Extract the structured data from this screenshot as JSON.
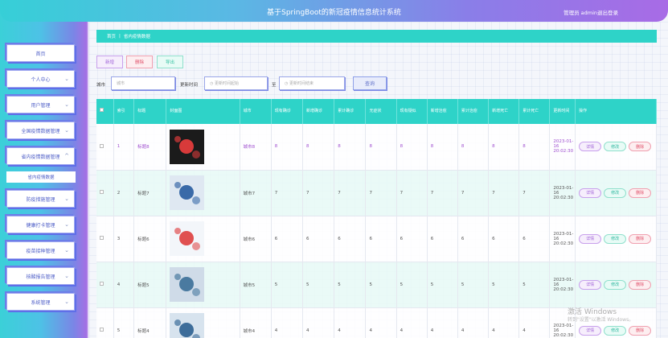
{
  "header": {
    "title": "基于SpringBoot的新冠疫情信息统计系统",
    "user": "管理员 admin",
    "logout": "退出登录"
  },
  "sidebar": {
    "items": [
      {
        "label": "首页",
        "chev": ""
      },
      {
        "label": "个人中心",
        "chev": "⌄"
      },
      {
        "label": "用户管理",
        "chev": "⌄"
      },
      {
        "label": "全国疫情数据管理",
        "chev": "⌄"
      },
      {
        "label": "省内疫情数据管理",
        "chev": "^"
      },
      {
        "label": "防疫措施管理",
        "chev": "⌄"
      },
      {
        "label": "健康打卡管理",
        "chev": "⌄"
      },
      {
        "label": "疫苗接种管理",
        "chev": "⌄"
      },
      {
        "label": "核酸报告管理",
        "chev": "⌄"
      },
      {
        "label": "系统管理",
        "chev": "⌄"
      }
    ],
    "sub_item": "省内疫情数据"
  },
  "breadcrumb": {
    "home": "首页",
    "sep": "|",
    "current": "省内疫情数据"
  },
  "toolbar": {
    "add": "新增",
    "delete": "删除",
    "export": "导出"
  },
  "search": {
    "city_label": "城市",
    "city_placeholder": "城市",
    "time_label": "更新时间",
    "start_placeholder": "更新时间起始",
    "to": "至",
    "end_placeholder": "更新时间结束",
    "query": "查询"
  },
  "table": {
    "headers": [
      "",
      "索引",
      "标题",
      "封面图",
      "城市",
      "现有确诊",
      "新增确诊",
      "累计确诊",
      "无症状",
      "现有疑似",
      "新增治愈",
      "累计治愈",
      "新增死亡",
      "累计死亡",
      "更新时间",
      "操作"
    ],
    "actions": {
      "detail": "详情",
      "edit": "修改",
      "delete": "删除"
    },
    "rows": [
      {
        "index": "1",
        "title": "标题8",
        "city": "城市8",
        "v": [
          "8",
          "8",
          "8",
          "8",
          "8",
          "8",
          "8",
          "8",
          "8"
        ],
        "time": "2023-01-16 20:02:30"
      },
      {
        "index": "2",
        "title": "标题7",
        "city": "城市7",
        "v": [
          "7",
          "7",
          "7",
          "7",
          "7",
          "7",
          "7",
          "7",
          "7"
        ],
        "time": "2023-01-16 20:02:30"
      },
      {
        "index": "3",
        "title": "标题6",
        "city": "城市6",
        "v": [
          "6",
          "6",
          "6",
          "6",
          "6",
          "6",
          "6",
          "6",
          "6"
        ],
        "time": "2023-01-16 20:02:30"
      },
      {
        "index": "4",
        "title": "标题5",
        "city": "城市5",
        "v": [
          "5",
          "5",
          "5",
          "5",
          "5",
          "5",
          "5",
          "5",
          "5"
        ],
        "time": "2023-01-16 20:02:30"
      },
      {
        "index": "5",
        "title": "标题4",
        "city": "城市4",
        "v": [
          "4",
          "4",
          "4",
          "4",
          "4",
          "4",
          "4",
          "4",
          "4"
        ],
        "time": "2023-01-16 20:02:30"
      }
    ]
  },
  "watermark": {
    "line1": "激活 Windows",
    "line2": "转到\"设置\"以激活 Windows。"
  }
}
